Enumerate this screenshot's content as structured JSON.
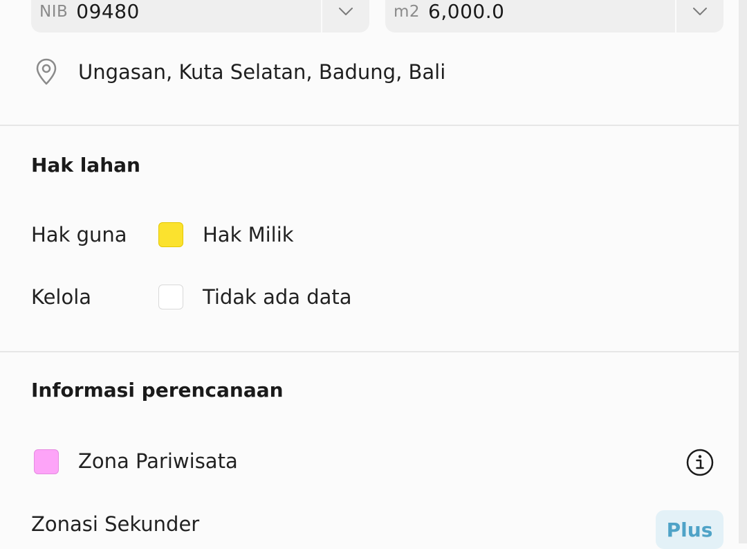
{
  "parcel": {
    "nib_prefix": "NIB",
    "nib_value": "09480",
    "area_prefix": "m2",
    "area_value": "6,000.0"
  },
  "location": {
    "icon": "location-pin-icon",
    "text": "Ungasan, Kuta Selatan, Badung, Bali"
  },
  "land_rights": {
    "title": "Hak lahan",
    "rows": [
      {
        "label": "Hak guna",
        "value": "Hak Milik",
        "color": "#fbe22e",
        "border": "#e5c800"
      },
      {
        "label": "Kelola",
        "value": "Tidak ada data",
        "color": "#ffffff",
        "border": "#d9d9d9"
      }
    ]
  },
  "planning": {
    "title": "Informasi perencanaan",
    "zone": {
      "label": "Zona Pariwisata",
      "color": "#fda4f8",
      "border": "#e58ae0"
    },
    "secondary_label": "Zonasi Sekunder",
    "badge": "Plus"
  },
  "icons": [
    "chevron-down-icon",
    "location-pin-icon",
    "info-icon"
  ]
}
